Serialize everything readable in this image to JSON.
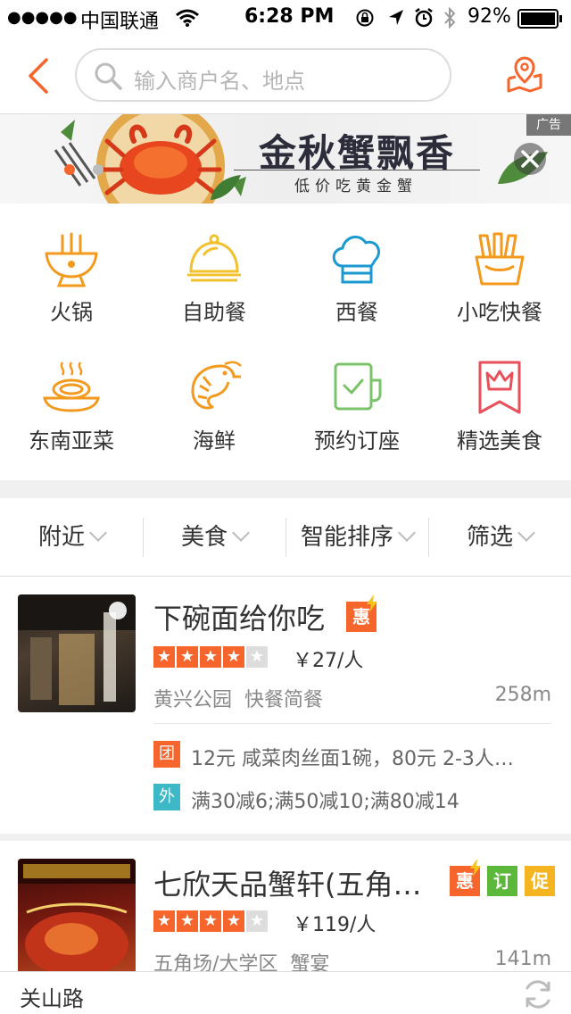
{
  "status_bar": {
    "signal": "●●●●●",
    "carrier": "中国联通",
    "time": "6:28 PM",
    "battery_pct": "92%"
  },
  "header": {
    "search_placeholder": "输入商户名、地点"
  },
  "banner": {
    "title": "金秋蟹飘香",
    "subtitle": "低价吃黄金蟹",
    "ad_label": "广告"
  },
  "categories": [
    {
      "label": "火锅",
      "icon": "hotpot-icon"
    },
    {
      "label": "自助餐",
      "icon": "buffet-cloche-icon"
    },
    {
      "label": "西餐",
      "icon": "chef-hat-icon"
    },
    {
      "label": "小吃快餐",
      "icon": "fries-icon"
    },
    {
      "label": "东南亚菜",
      "icon": "noodle-bowl-icon"
    },
    {
      "label": "海鲜",
      "icon": "shrimp-icon"
    },
    {
      "label": "预约订座",
      "icon": "reservation-cup-icon"
    },
    {
      "label": "精选美食",
      "icon": "crown-bookmark-icon"
    }
  ],
  "filters": [
    {
      "label": "附近"
    },
    {
      "label": "美食"
    },
    {
      "label": "智能排序"
    },
    {
      "label": "筛选"
    }
  ],
  "restaurants": [
    {
      "name": "下碗面给你吃",
      "rating": 4,
      "price": "￥27/人",
      "area": "黄兴公园",
      "category": "快餐简餐",
      "distance": "258m",
      "badges": [
        "惠"
      ],
      "deals": [
        {
          "tag": "团",
          "text": "12元 咸菜肉丝面1碗，80元 2-3人…"
        },
        {
          "tag": "外",
          "text": "满30减6;满50减10;满80减14"
        }
      ]
    },
    {
      "name": "七欣天品蟹轩(五角…",
      "rating": 4,
      "price": "￥119/人",
      "area": "五角场/大学区",
      "category": "蟹宴",
      "distance": "141m",
      "badges": [
        "惠",
        "订",
        "促"
      ]
    }
  ],
  "bottom_bar": {
    "location": "关山路"
  },
  "colors": {
    "brand_orange": "#f6652b",
    "deal_team": "#f6652b",
    "deal_takeout": "#3cb8c6",
    "badge_book": "#5cb83a",
    "badge_promo": "#f5b520"
  }
}
